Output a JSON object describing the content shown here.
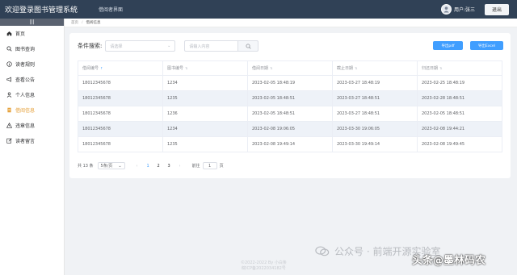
{
  "header": {
    "title": "欢迎登录图书管理系统",
    "subtitle": "借阅者界面",
    "username": "用户:张三",
    "logout_label": "退出"
  },
  "sidebar": {
    "collapse_label": "|||",
    "items": [
      {
        "label": "首页",
        "icon": "home-icon",
        "active": false
      },
      {
        "label": "图书查询",
        "icon": "search-icon",
        "active": false
      },
      {
        "label": "读者规则",
        "icon": "info-icon",
        "active": false
      },
      {
        "label": "查看公告",
        "icon": "megaphone-icon",
        "active": false
      },
      {
        "label": "个人信息",
        "icon": "user-icon",
        "active": false
      },
      {
        "label": "借阅信息",
        "icon": "document-icon",
        "active": true
      },
      {
        "label": "违章信息",
        "icon": "warning-icon",
        "active": false
      },
      {
        "label": "读者留言",
        "icon": "edit-icon",
        "active": false
      }
    ]
  },
  "breadcrumb": {
    "home": "首页",
    "current": "借阅信息"
  },
  "search": {
    "label": "条件搜索:",
    "select_placeholder": "请选择",
    "input_placeholder": "请输入内容"
  },
  "actions": {
    "export_pdf": "导出pdf",
    "export_excel": "导出Excel"
  },
  "table": {
    "columns": [
      "借阅编号",
      "图书编号",
      "借阅日期",
      "截止日期",
      "归还日期"
    ],
    "rows": [
      [
        "18012345678",
        "1234",
        "2023-02-05 18:48:19",
        "2023-03-27 18:48:19",
        "2023-02-25 18:48:19"
      ],
      [
        "18012345678",
        "1235",
        "2023-02-05 18:48:51",
        "2023-03-27 18:48:51",
        "2023-02-28 18:48:51"
      ],
      [
        "18012345678",
        "1236",
        "2023-02-05 18:48:51",
        "2023-03-27 18:48:51",
        "2023-02-05 18:48:51"
      ],
      [
        "18012345678",
        "1234",
        "2023-02-08 19:06:05",
        "2023-03-30 19:06:05",
        "2023-02-08 19:44:21"
      ],
      [
        "18012345678",
        "1235",
        "2023-02-08 19:49:14",
        "2023-03-30 19:49:14",
        "2023-02-08 19:49:45"
      ]
    ]
  },
  "pagination": {
    "total": "共 13 条",
    "page_size": "5条/页",
    "pages": [
      "1",
      "2",
      "3"
    ],
    "current_page": "1",
    "goto_label": "前往",
    "goto_value": "1",
    "page_unit": "页"
  },
  "footer": {
    "copyright": "©2022-2022 By 小白条",
    "icp": "皖ICP备2022034182号"
  },
  "watermarks": {
    "wechat": "公众号 · 前端开源实验室",
    "toutiao": "头条@墨林码农"
  },
  "colors": {
    "header_bg": "#304156",
    "primary": "#409eff",
    "active_menu": "#e6a23c"
  }
}
